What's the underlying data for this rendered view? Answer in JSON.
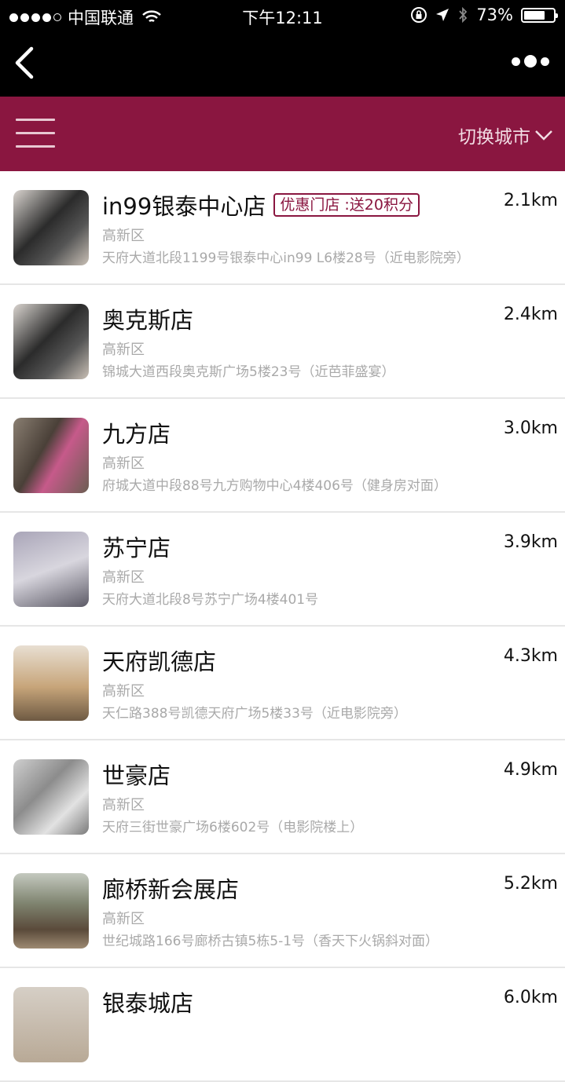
{
  "status_bar": {
    "carrier": "中国联通",
    "time": "下午12:11",
    "battery": "73%",
    "battery_level": 0.73
  },
  "header": {
    "city_switch_label": "切换城市"
  },
  "stores": [
    {
      "name": "in99银泰中心店",
      "badge": "优惠门店 :送20积分",
      "district": "高新区",
      "address": "天府大道北段1199号银泰中心in99 L6楼28号（近电影院旁）",
      "distance": "2.1km"
    },
    {
      "name": "奥克斯店",
      "badge": "",
      "district": "高新区",
      "address": "锦城大道西段奥克斯广场5楼23号（近芭菲盛宴）",
      "distance": "2.4km"
    },
    {
      "name": "九方店",
      "badge": "",
      "district": "高新区",
      "address": "府城大道中段88号九方购物中心4楼406号（健身房对面）",
      "distance": "3.0km"
    },
    {
      "name": "苏宁店",
      "badge": "",
      "district": "高新区",
      "address": "天府大道北段8号苏宁广场4楼401号",
      "distance": "3.9km"
    },
    {
      "name": "天府凯德店",
      "badge": "",
      "district": "高新区",
      "address": "天仁路388号凯德天府广场5楼33号（近电影院旁）",
      "distance": "4.3km"
    },
    {
      "name": "世豪店",
      "badge": "",
      "district": "高新区",
      "address": "天府三街世豪广场6楼602号（电影院楼上）",
      "distance": "4.9km"
    },
    {
      "name": "廊桥新会展店",
      "badge": "",
      "district": "高新区",
      "address": "世纪城路166号廊桥古镇5栋5-1号（香天下火锅斜对面）",
      "distance": "5.2km"
    },
    {
      "name": "银泰城店",
      "badge": "",
      "district": "",
      "address": "",
      "distance": "6.0km"
    }
  ],
  "colors": {
    "brand": "#8a1640",
    "muted_text": "#a9a9a9"
  }
}
